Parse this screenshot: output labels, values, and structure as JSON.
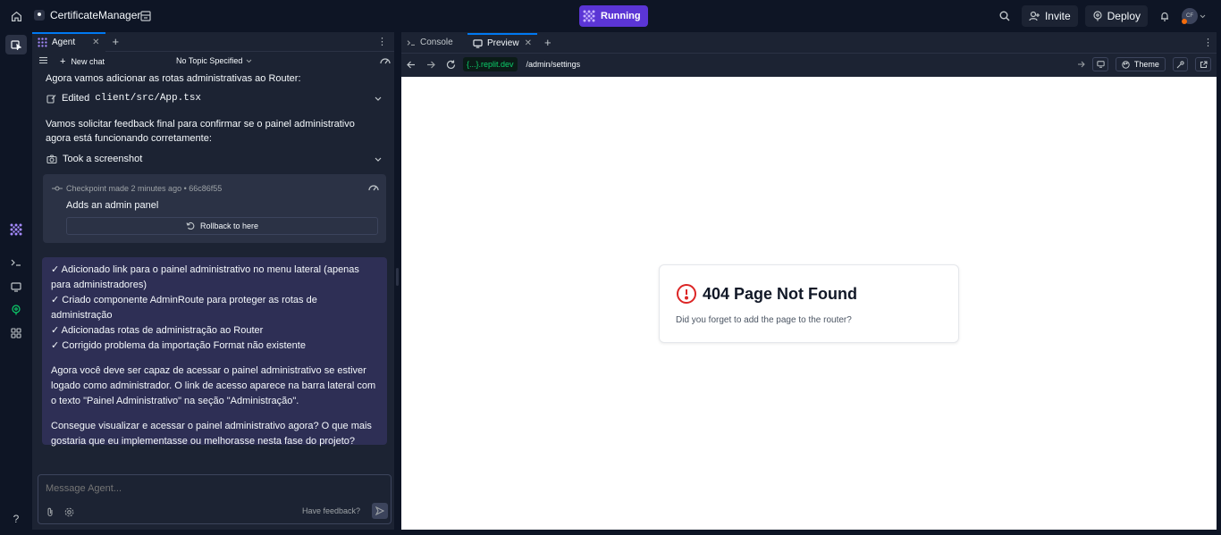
{
  "topbar": {
    "project_name": "CertificateManager",
    "run_status": "Running",
    "invite_label": "Invite",
    "deploy_label": "Deploy",
    "avatar_initials": "CF"
  },
  "agent_panel": {
    "tab_label": "Agent",
    "new_chat_label": "New chat",
    "topic_label": "No Topic Specified",
    "messages": {
      "intro": "Agora vamos adicionar as rotas administrativas ao Router:",
      "edited_prefix": "Edited",
      "edited_file": "client/src/App.tsx",
      "feedback_request": "Vamos solicitar feedback final para confirmar se o painel administrativo agora está funcionando corretamente:",
      "screenshot_label": "Took a screenshot"
    },
    "checkpoint": {
      "meta": "Checkpoint made 2 minutes ago • 66c86f55",
      "title": "Adds an admin panel",
      "rollback_label": "Rollback to here"
    },
    "agent_reply": {
      "items": [
        "✓ Adicionado link para o painel administrativo no menu lateral (apenas para administradores)",
        "✓ Criado componente AdminRoute para proteger as rotas de administração",
        "✓ Adicionadas rotas de administração ao Router",
        "✓ Corrigido problema da importação Format não existente"
      ],
      "paragraph1": "Agora você deve ser capaz de acessar o painel administrativo se estiver logado como administrador. O link de acesso aparece na barra lateral com o texto \"Painel Administrativo\" na seção \"Administração\".",
      "paragraph2": "Consegue visualizar e acessar o painel administrativo agora? O que mais gostaria que eu implementasse ou melhorasse nesta fase do projeto?"
    },
    "composer": {
      "placeholder": "Message Agent...",
      "feedback_label": "Have feedback?"
    }
  },
  "preview_panel": {
    "tabs": [
      {
        "label": "Console"
      },
      {
        "label": "Preview"
      }
    ],
    "url_domain": "{...}.replit.dev",
    "url_path": "/admin/settings",
    "theme_label": "Theme",
    "page": {
      "title": "404 Page Not Found",
      "subtitle": "Did you forget to add the page to the router?"
    }
  },
  "colors": {
    "bg": "#0e1525",
    "panel": "#1c2333",
    "accent": "#5b35d5",
    "url_green": "#0cce6b",
    "error_red": "#dc2626"
  }
}
